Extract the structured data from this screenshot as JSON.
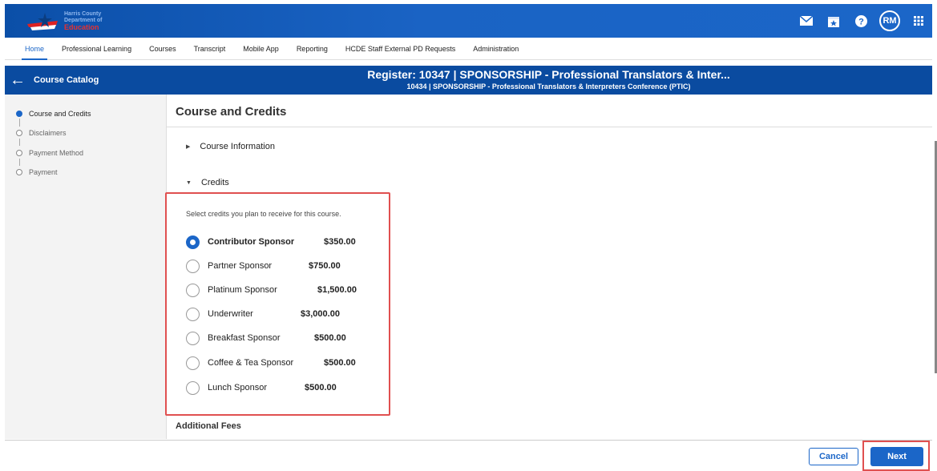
{
  "logo": {
    "line1": "Harris County",
    "line2": "Department of",
    "line3": "Education"
  },
  "topbar": {
    "avatar_initials": "RM",
    "accent": "#1b66c8"
  },
  "nav": {
    "items": [
      "Home",
      "Professional Learning",
      "Courses",
      "Transcript",
      "Mobile App",
      "Reporting",
      "HCDE Staff External PD Requests",
      "Administration"
    ]
  },
  "header": {
    "back_label": "Course Catalog",
    "title": "Register: 10347 | SPONSORSHIP - Professional Translators & Inter...",
    "subtitle": "10434 | SPONSORSHIP - Professional Translators & Interpreters Conference (PTIC)"
  },
  "steps": [
    "Course and Credits",
    "Disclaimers",
    "Payment Method",
    "Payment"
  ],
  "main": {
    "title": "Course and Credits",
    "course_info_label": "Course Information",
    "credits_label": "Credits",
    "instructions": "Select credits you plan to receive for this course.",
    "options": [
      {
        "label": "Contributor Sponsor",
        "price": "$350.00",
        "selected": true
      },
      {
        "label": "Partner Sponsor",
        "price": "$750.00",
        "selected": false
      },
      {
        "label": "Platinum Sponsor",
        "price": "$1,500.00",
        "selected": false
      },
      {
        "label": "Underwriter",
        "price": "$3,000.00",
        "selected": false
      },
      {
        "label": "Breakfast Sponsor",
        "price": "$500.00",
        "selected": false
      },
      {
        "label": "Coffee & Tea Sponsor",
        "price": "$500.00",
        "selected": false
      },
      {
        "label": "Lunch Sponsor",
        "price": "$500.00",
        "selected": false
      }
    ],
    "additional_fees_label": "Additional Fees"
  },
  "footer": {
    "cancel_label": "Cancel",
    "next_label": "Next"
  }
}
